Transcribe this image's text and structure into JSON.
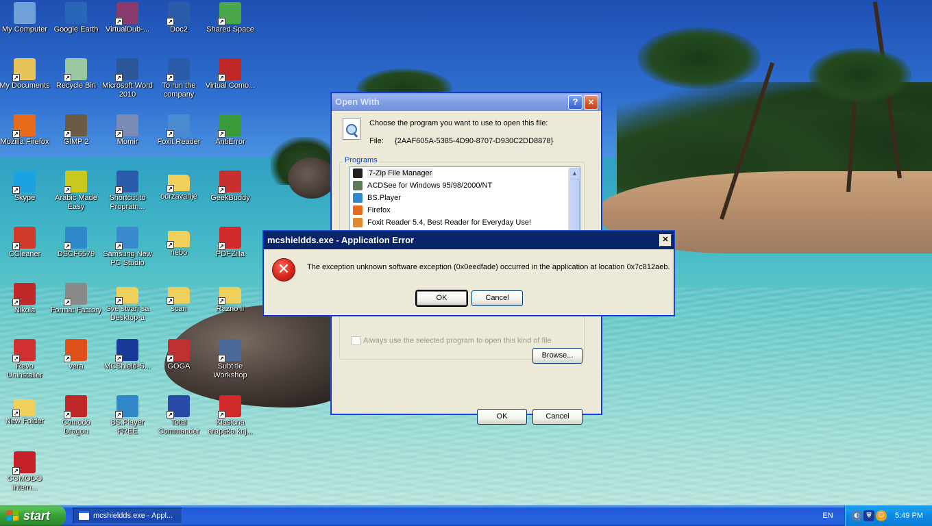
{
  "desktop_icons": [
    {
      "label": "My Computer",
      "icon": "computer-icon",
      "color": "#6fa0d8"
    },
    {
      "label": "Google Earth",
      "icon": "globe-icon",
      "color": "#2a66b8"
    },
    {
      "label": "VirtualDub-...",
      "icon": "film-archive-icon",
      "color": "#8a3b6e"
    },
    {
      "label": "Doc2",
      "icon": "word-doc-icon",
      "color": "#2a5caa"
    },
    {
      "label": "Shared Space",
      "icon": "shared-space-icon",
      "color": "#4aa84a"
    },
    {
      "label": "My Documents",
      "icon": "folder-docs-icon",
      "color": "#e8c35a"
    },
    {
      "label": "Recycle Bin",
      "icon": "recycle-bin-icon",
      "color": "#9ac7a2"
    },
    {
      "label": "Microsoft Word 2010",
      "icon": "word-icon",
      "color": "#2b579a"
    },
    {
      "label": "To run the company",
      "icon": "word-doc-icon",
      "color": "#2a5caa"
    },
    {
      "label": "Virtual Como...",
      "icon": "comodo-icon",
      "color": "#c02828"
    },
    {
      "label": "Mozilla Firefox",
      "icon": "firefox-icon",
      "color": "#e76b1a"
    },
    {
      "label": "GIMP 2",
      "icon": "gimp-icon",
      "color": "#6b5b45"
    },
    {
      "label": "Momir",
      "icon": "penguin-icon",
      "color": "#7a8bb8"
    },
    {
      "label": "Foxit Reader",
      "icon": "foxit-icon",
      "color": "#4a8ad0"
    },
    {
      "label": "AntiError",
      "icon": "antierror-icon",
      "color": "#3a9a3a"
    },
    {
      "label": "Skype",
      "icon": "skype-icon",
      "color": "#1aa3e0"
    },
    {
      "label": "Arabic Made Easy",
      "icon": "arabic-icon",
      "color": "#c8c81e"
    },
    {
      "label": "Shortcut to Propratn...",
      "icon": "word-doc-icon",
      "color": "#2a5caa"
    },
    {
      "label": "odrzavanje",
      "icon": "folder-icon",
      "color": "#f0cf5a"
    },
    {
      "label": "GeekBuddy",
      "icon": "geekbuddy-icon",
      "color": "#c83030"
    },
    {
      "label": "CCleaner",
      "icon": "ccleaner-icon",
      "color": "#d03a2a"
    },
    {
      "label": "DSCF6579",
      "icon": "bsplayer-icon",
      "color": "#2f88c8"
    },
    {
      "label": "Samsung New PC Studio",
      "icon": "samsung-icon",
      "color": "#3a8ad0"
    },
    {
      "label": "nebo",
      "icon": "folder-icon",
      "color": "#f0cf5a"
    },
    {
      "label": "PDFZilla",
      "icon": "pdf-icon",
      "color": "#d22a2a"
    },
    {
      "label": "Nikola",
      "icon": "car-icon",
      "color": "#c0282a"
    },
    {
      "label": "Format Factory",
      "icon": "format-factory-icon",
      "color": "#8a8a8a"
    },
    {
      "label": "Sve stvari sa Desktop-a",
      "icon": "folder-icon",
      "color": "#f0cf5a"
    },
    {
      "label": "scan",
      "icon": "folder-icon",
      "color": "#f0cf5a"
    },
    {
      "label": "Razno II",
      "icon": "folder-icon",
      "color": "#f0cf5a"
    },
    {
      "label": "Revo Uninstaller",
      "icon": "revo-icon",
      "color": "#d03030"
    },
    {
      "label": "vera",
      "icon": "flower-icon",
      "color": "#e0501a"
    },
    {
      "label": "MCShield-S...",
      "icon": "shield-icon",
      "color": "#1a3a9a"
    },
    {
      "label": "GOGA",
      "icon": "shoe-icon",
      "color": "#c03030"
    },
    {
      "label": "Subtitle Workshop",
      "icon": "subtitle-icon",
      "color": "#4a6a9a"
    },
    {
      "label": "New Folder",
      "icon": "folder-icon",
      "color": "#f0cf5a"
    },
    {
      "label": "Comodo Dragon",
      "icon": "comodo-icon",
      "color": "#c02828"
    },
    {
      "label": "BS.Player FREE",
      "icon": "bsplayer-icon",
      "color": "#2f88c8"
    },
    {
      "label": "Total Commander",
      "icon": "floppy-icon",
      "color": "#2a4aa8"
    },
    {
      "label": "Klasicna arapska knj...",
      "icon": "pdf-icon",
      "color": "#d22a2a"
    },
    {
      "label": "COMODO Intern...",
      "icon": "comodo-c-icon",
      "color": "#c8202a"
    }
  ],
  "open_with": {
    "title": "Open With",
    "prompt": "Choose the program you want to use to open this file:",
    "file_label": "File:",
    "file_name": "{2AAF605A-5385-4D90-8707-D930C2DD8878}",
    "programs_label": "Programs",
    "programs": [
      {
        "name": "7-Zip File Manager",
        "icon": "7zip-icon",
        "color": "#222222",
        "selected": true
      },
      {
        "name": "ACDSee for Windows 95/98/2000/NT",
        "icon": "acdsee-icon",
        "color": "#5a7a5a",
        "selected": false
      },
      {
        "name": "BS.Player",
        "icon": "bsplayer-icon",
        "color": "#2f88c8",
        "selected": false
      },
      {
        "name": "Firefox",
        "icon": "firefox-icon",
        "color": "#e76b1a",
        "selected": false
      },
      {
        "name": "Foxit Reader 5.4, Best Reader for Everyday Use!",
        "icon": "foxit-icon",
        "color": "#e08a2a",
        "selected": false
      }
    ],
    "always_use_label": "Always use the selected program to open this kind of file",
    "browse_label": "Browse...",
    "ok_label": "OK",
    "cancel_label": "Cancel",
    "help_glyph": "?",
    "close_glyph": "✕"
  },
  "error_dialog": {
    "title": "mcshieldds.exe - Application Error",
    "message": "The exception unknown software exception (0x0eedfade) occurred in the application at location 0x7c812aeb.",
    "ok_label": "OK",
    "cancel_label": "Cancel",
    "close_glyph": "✕",
    "icon_glyph": "✕"
  },
  "taskbar": {
    "start_label": "start",
    "task_label": "mcshieldds.exe - Appl...",
    "language": "EN",
    "clock": "5:49 PM"
  }
}
